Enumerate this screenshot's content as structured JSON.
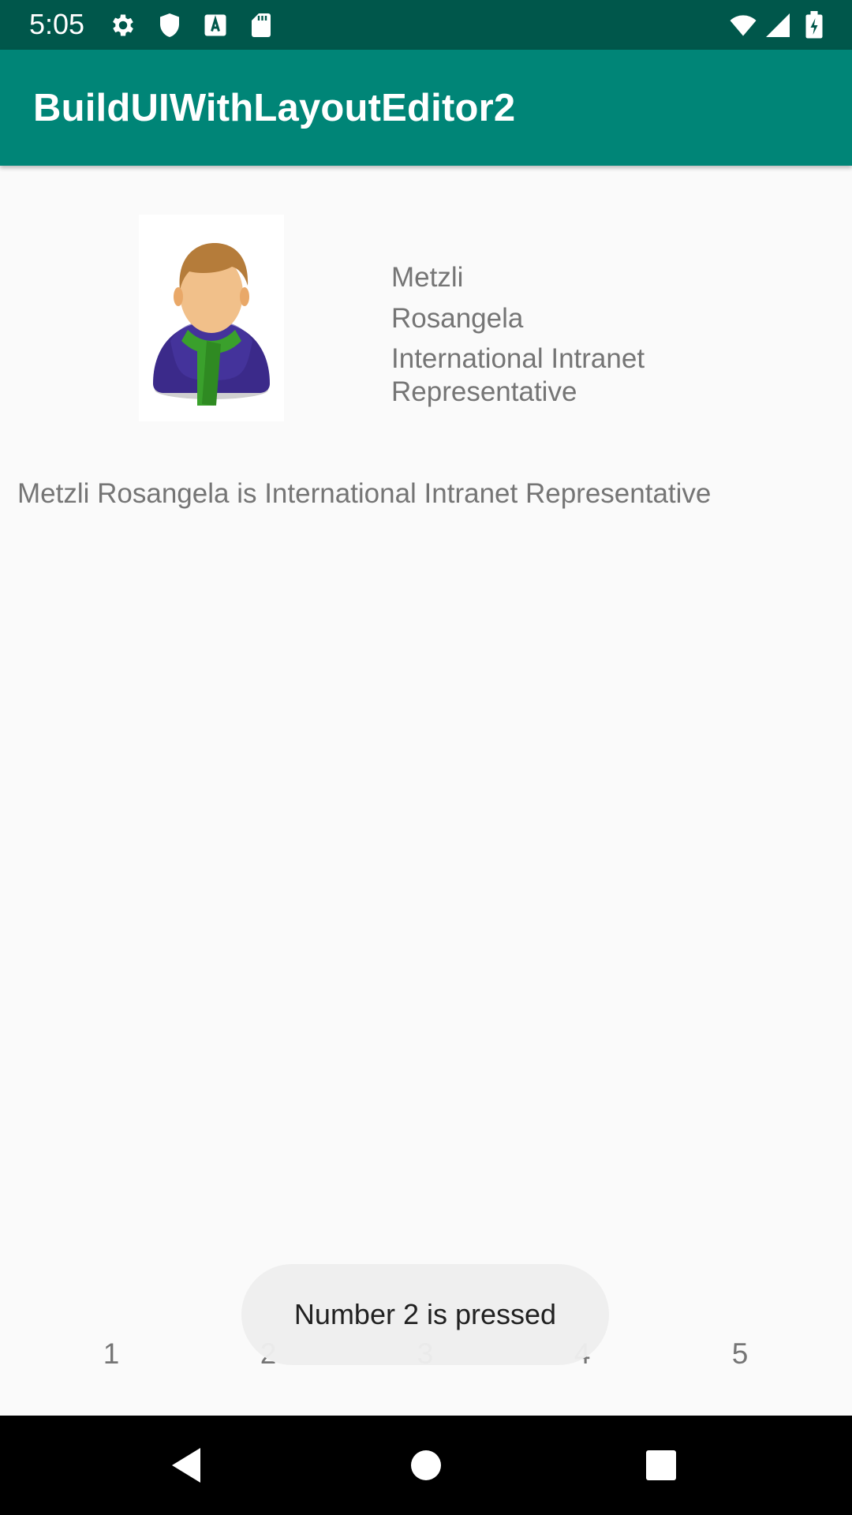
{
  "status_bar": {
    "time": "5:05",
    "icons_left": [
      "gear-icon",
      "shield-icon",
      "a-font-icon",
      "sd-card-icon"
    ],
    "icons_right": [
      "wifi-icon",
      "signal-icon",
      "battery-icon"
    ]
  },
  "app_bar": {
    "title": "BuildUIWithLayoutEditor2"
  },
  "profile": {
    "avatar_icon": "user-avatar-icon",
    "first_name": "Metzli",
    "last_name": "Rosangela",
    "role": "International Intranet Representative"
  },
  "summary": "Metzli Rosangela is International Intranet Representative",
  "numbers": [
    "1",
    "2",
    "3",
    "4",
    "5"
  ],
  "toast": {
    "message": "Number 2 is pressed"
  },
  "nav_bar": {
    "buttons": [
      "back-icon",
      "home-icon",
      "recents-icon"
    ]
  },
  "colors": {
    "status_bar": "#00574b",
    "app_bar": "#008577",
    "background": "#fafafa",
    "text_secondary": "#757575"
  }
}
